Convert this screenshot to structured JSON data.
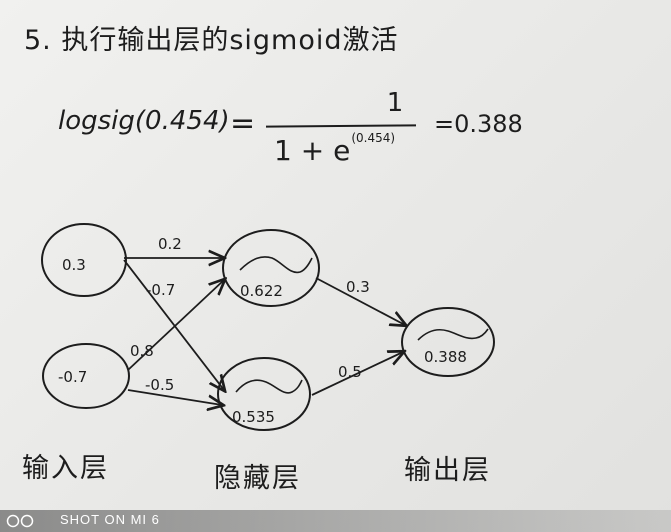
{
  "title": "5. 执行输出层的sigmoid激活",
  "formula": {
    "lhs": "logsig(0.454)",
    "equals": "=",
    "numerator": "1",
    "denominator_base": "1 + e",
    "denominator_exponent": "(0.454)",
    "result": "=0.388"
  },
  "network": {
    "input_nodes": [
      "0.3",
      "-0.7"
    ],
    "hidden_nodes": [
      "0.622",
      "0.535"
    ],
    "output_nodes": [
      "0.388"
    ],
    "weights": {
      "in1_hid1": "0.2",
      "in1_hid2": "-0.7",
      "in2_hid1": "0.8",
      "in2_hid2": "-0.5",
      "hid1_out": "0.3",
      "hid2_out": "0.5"
    }
  },
  "labels": {
    "input_layer": "输入层",
    "hidden_layer": "隐藏层",
    "output_layer": "输出层"
  },
  "watermark": {
    "text": "SHOT ON MI 6"
  },
  "colors": {
    "ink": "#1d1d1d",
    "paper": "#ececea"
  }
}
